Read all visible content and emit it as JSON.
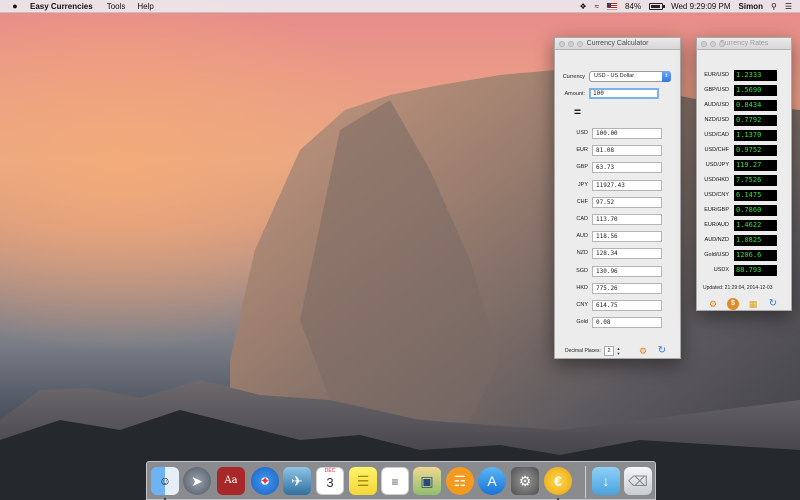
{
  "menubar": {
    "apple_icon": "apple-icon",
    "app_name": "Easy Currencies",
    "menus": [
      "Tools",
      "Help"
    ],
    "battery": "84%",
    "datetime": "Wed 9:29:09 PM",
    "user": "Simon"
  },
  "calculator": {
    "title": "Currency Calculator",
    "currency_label": "Currency",
    "currency_value": "USD - US Dollar",
    "amount_label": "Amount:",
    "amount_value": "100",
    "equals": "=",
    "results": [
      {
        "code": "USD",
        "value": "100.00"
      },
      {
        "code": "EUR",
        "value": "81.08"
      },
      {
        "code": "GBP",
        "value": "63.73"
      },
      {
        "code": "JPY",
        "value": "11927.43"
      },
      {
        "code": "CHF",
        "value": "97.52"
      },
      {
        "code": "CAD",
        "value": "113.70"
      },
      {
        "code": "AUD",
        "value": "118.56"
      },
      {
        "code": "NZD",
        "value": "128.34"
      },
      {
        "code": "SGD",
        "value": "130.96"
      },
      {
        "code": "HKD",
        "value": "775.26"
      },
      {
        "code": "CNY",
        "value": "614.75"
      },
      {
        "code": "Gold",
        "value": "0.08"
      }
    ],
    "decimal_label": "Decimal Places:",
    "decimal_value": "2"
  },
  "rates": {
    "title": "Currency Rates",
    "items": [
      {
        "pair": "EUR/USD",
        "value": "1.2333"
      },
      {
        "pair": "GBP/USD",
        "value": "1.5690"
      },
      {
        "pair": "AUD/USD",
        "value": "0.8434"
      },
      {
        "pair": "NZD/USD",
        "value": "0.7792"
      },
      {
        "pair": "USD/CAD",
        "value": "1.1370"
      },
      {
        "pair": "USD/CHF",
        "value": "0.9752"
      },
      {
        "pair": "USD/JPY",
        "value": "119.27"
      },
      {
        "pair": "USD/HKD",
        "value": "7.7526"
      },
      {
        "pair": "USD/CNY",
        "value": "6.1475"
      },
      {
        "pair": "EUR/GBP",
        "value": "0.7860"
      },
      {
        "pair": "EUR/AUD",
        "value": "1.4622"
      },
      {
        "pair": "AUD/NZD",
        "value": "1.0825"
      },
      {
        "pair": "Gold/USD",
        "value": "1206.6"
      },
      {
        "pair": "USDX",
        "value": "88.793"
      }
    ],
    "updated": "Updated: 21:29:04, 2014-12-03"
  },
  "calendar_icon": {
    "month": "DEC",
    "day": "3"
  },
  "dictionary_icon_text": "Aa",
  "colors": {
    "ticker_green": "#2fe33a",
    "accent_blue": "#2e79e9",
    "gear_orange": "#e8801a"
  }
}
